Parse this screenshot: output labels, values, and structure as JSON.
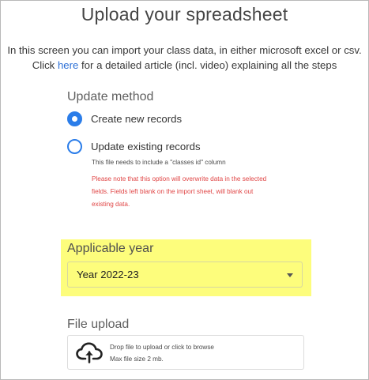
{
  "title": "Upload your spreadsheet",
  "intro": {
    "line1": "In this screen you can import your class data, in either microsoft excel or csv.",
    "line2_prefix": "Click ",
    "line2_link": "here",
    "line2_suffix": " for a detailed article (incl. video) explaining all the steps"
  },
  "update_method": {
    "label": "Update method",
    "options": [
      {
        "label": "Create new records",
        "selected": true
      },
      {
        "label": "Update existing records",
        "selected": false
      }
    ],
    "hint": "This file needs to include a \"classes id\" column",
    "warning": {
      "line1": "Please note that this option will overwrite data in the selected",
      "line2": "fields. Fields left blank on the import sheet, will blank out",
      "line3": "existing data."
    }
  },
  "applicable_year": {
    "label": "Applicable year",
    "selected": "Year 2022-23",
    "highlight_color": "#fdfd7c"
  },
  "file_upload": {
    "label": "File upload",
    "line1": "Drop file to upload or click to browse",
    "line2": "Max file size 2 mb.",
    "icon": "cloud-upload-icon"
  },
  "colors": {
    "accent": "#2b7de9",
    "link": "#2b6fd6",
    "warning": "#e04545"
  }
}
